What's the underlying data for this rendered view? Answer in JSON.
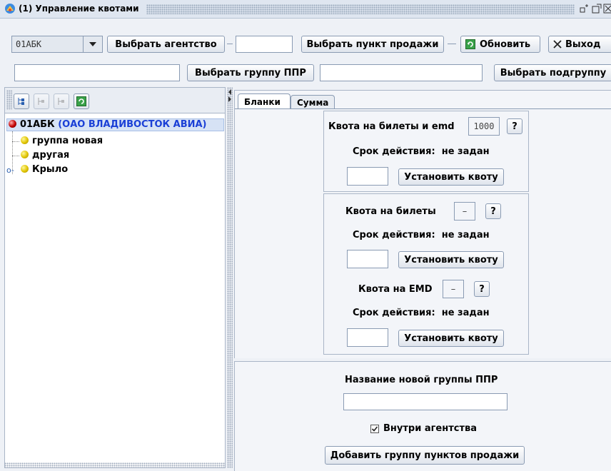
{
  "window": {
    "title": "(1) Управление квотами",
    "controls": [
      "minimize-icon",
      "maximize-icon",
      "close-icon"
    ]
  },
  "toolbar1": {
    "agency_value": "01АБК",
    "select_agency": "Выбрать агентство",
    "point_value": "",
    "select_point": "Выбрать пункт продажи",
    "refresh": "Обновить",
    "exit": "Выход"
  },
  "toolbar2": {
    "group_value": "",
    "select_group": "Выбрать группу ППР",
    "subgroup_value": "",
    "select_subgroup": "Выбрать подгруппу"
  },
  "tree": {
    "root_code": "01АБК",
    "root_name": "(ОАО ВЛАДИВОСТОК АВИА)",
    "items": [
      {
        "label": "группа новая"
      },
      {
        "label": "другая"
      },
      {
        "label": "Крыло"
      }
    ]
  },
  "tabs": [
    {
      "label": "Бланки",
      "active": true
    },
    {
      "label": "Сумма",
      "active": false
    }
  ],
  "quota_all": {
    "label": "Квота на билеты и emd",
    "value": "1000",
    "help": "?",
    "validity": "Срок действия:  не задан",
    "input": "",
    "set_button": "Установить квоту"
  },
  "quota_tickets": {
    "label": "Квота на билеты",
    "value": "–",
    "help": "?",
    "validity": "Срок действия:  не задан",
    "input": "",
    "set_button": "Установить квоту"
  },
  "quota_emd": {
    "label": "Квота на EMD",
    "value": "–",
    "help": "?",
    "validity": "Срок действия:  не задан",
    "input": "",
    "set_button": "Установить квоту"
  },
  "new_group": {
    "title": "Название новой группы ППР",
    "name_value": "",
    "within_agency": "Внутри агентства",
    "within_agency_checked": true,
    "add_button": "Добавить группу пунктов продажи"
  }
}
